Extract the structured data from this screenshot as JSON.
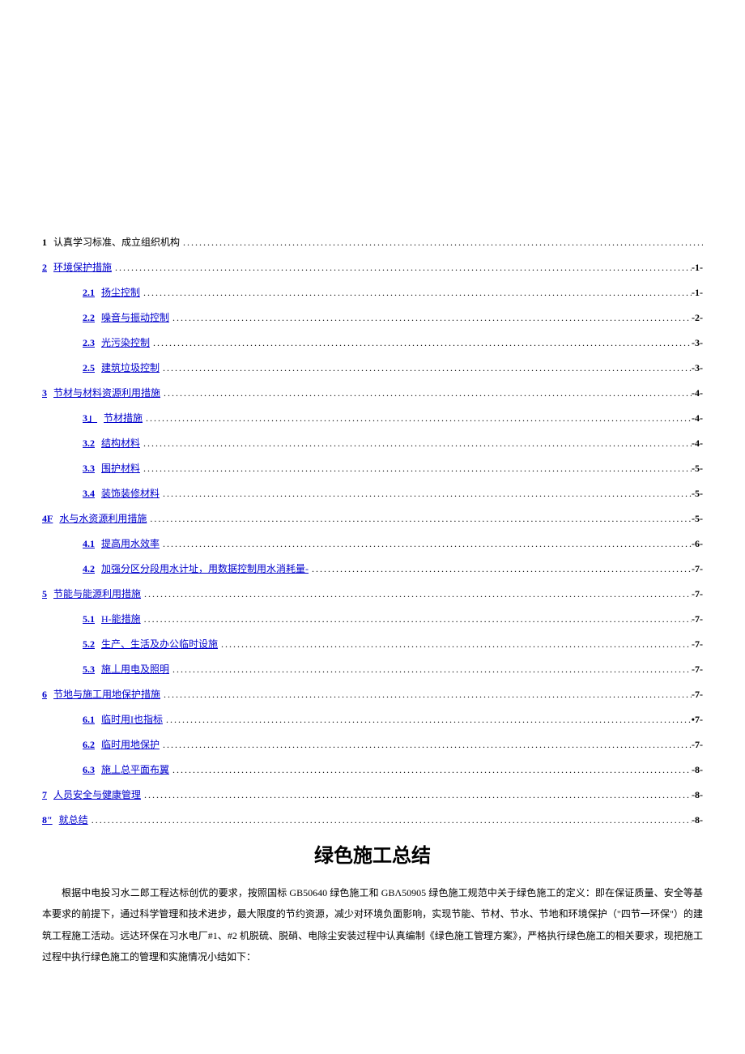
{
  "toc": [
    {
      "level": 0,
      "num": "1",
      "label": "认真学习标准、成立组织机构",
      "page": "",
      "numLink": false,
      "labelLink": false
    },
    {
      "level": 0,
      "num": "2",
      "label": "环境保护措施",
      "page": "-1-",
      "numLink": true,
      "labelLink": true
    },
    {
      "level": 1,
      "num": "2.1",
      "label": "扬尘控制",
      "page": "-1-",
      "numLink": true,
      "labelLink": true
    },
    {
      "level": 1,
      "num": "2.2",
      "label": "噪音与振动控制",
      "page": "-2-",
      "numLink": true,
      "labelLink": true
    },
    {
      "level": 1,
      "num": "2.3",
      "label": "光污染控制",
      "page": "-3-",
      "numLink": true,
      "labelLink": true
    },
    {
      "level": 1,
      "num": "2.5",
      "label": "建筑垃圾控制",
      "page": "-3-",
      "numLink": true,
      "labelLink": true
    },
    {
      "level": 0,
      "num": "3",
      "label": "节材与材料资源利用措施",
      "page": "-4-",
      "numLink": true,
      "labelLink": true
    },
    {
      "level": 1,
      "num": "3」",
      "label": "节材措施",
      "page": "-4-",
      "numLink": true,
      "labelLink": true
    },
    {
      "level": 1,
      "num": "3.2",
      "label": "结构材料",
      "page": "-4-",
      "numLink": true,
      "labelLink": true
    },
    {
      "level": 1,
      "num": "3.3",
      "label": "围护材料",
      "page": "-5-",
      "numLink": true,
      "labelLink": true
    },
    {
      "level": 1,
      "num": "3.4",
      "label": "装饰装修材料",
      "page": "-5-",
      "numLink": true,
      "labelLink": true
    },
    {
      "level": 0,
      "num": "4F",
      "label": "水与水资源利用措施",
      "page": "-5-",
      "numLink": true,
      "labelLink": true
    },
    {
      "level": 1,
      "num": "4.1",
      "label": "提高用水效率",
      "page": "-6-",
      "numLink": true,
      "labelLink": true
    },
    {
      "level": 1,
      "num": "4.2",
      "label": "加强分区分段用水计址，用数据控制用水消耗量-",
      "page": "-7-",
      "numLink": true,
      "labelLink": true
    },
    {
      "level": 0,
      "num": "5",
      "label": "节能与能源利用措施",
      "page": "-7-",
      "numLink": true,
      "labelLink": true
    },
    {
      "level": 1,
      "num": "5.1",
      "label": "H-能措施",
      "page": "-7-",
      "numLink": true,
      "labelLink": true
    },
    {
      "level": 1,
      "num": "5.2",
      "label": "生产、生活及办公临时设施",
      "page": "-7-",
      "numLink": true,
      "labelLink": true
    },
    {
      "level": 1,
      "num": "5.3",
      "label": "施丄用电及照明",
      "page": "-7-",
      "numLink": true,
      "labelLink": true
    },
    {
      "level": 0,
      "num": "6",
      "label": "节地与施工用地保护措施",
      "page": "-7-",
      "numLink": true,
      "labelLink": true
    },
    {
      "level": 1,
      "num": "6.1",
      "label": "临时用I也指标",
      "page": "•7-",
      "numLink": true,
      "labelLink": true
    },
    {
      "level": 1,
      "num": "6.2",
      "label": "临时用地保护",
      "page": "-7-",
      "numLink": true,
      "labelLink": true
    },
    {
      "level": 1,
      "num": "6.3",
      "label": "施丄总平面布翼",
      "page": "-8-",
      "numLink": true,
      "labelLink": true
    },
    {
      "level": 0,
      "num": "7",
      "label": "人员安全与健康管理",
      "page": "-8-",
      "numLink": true,
      "labelLink": true
    },
    {
      "level": 0,
      "num": "8\"",
      "label": "就总结",
      "page": "-8-",
      "numLink": true,
      "labelLink": true
    }
  ],
  "title": "绿色施工总结",
  "body": "根据中电投习水二郎工程达标创优的要求，按照国标 GB50640 绿色施工和 GBΛ50905 绿色施工规范中关于绿色施工的定义：即在保证质量、安全等基本要求的前提下，通过科学管理和技术进步，最大限度的节约资源，减少对环境负面影响，实现节能、节材、节水、节地和环境保护（\"四节一环保\"）的建筑工程施工活动。远达环保在习水电厂#1、#2 机脱硫、脱硝、电除尘安装过程中认真编制《绿色施工管理方案》，严格执行绿色施工的相关要求，现把施工过程中执行绿色施工的管理和实施情况小结如下："
}
